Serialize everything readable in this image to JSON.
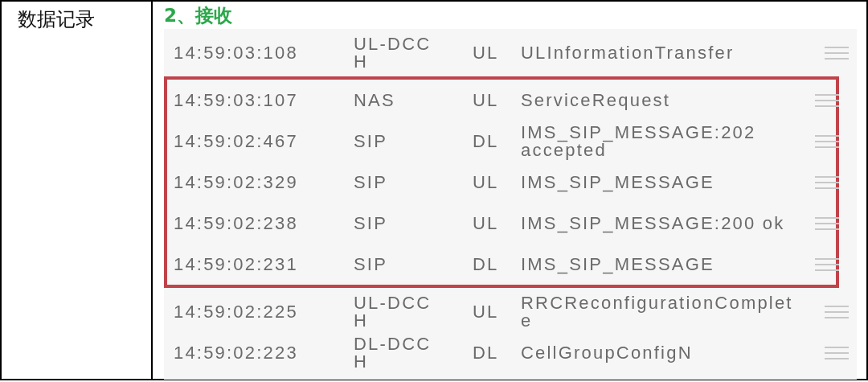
{
  "table_label": "数据记录",
  "section_title": "2、接收",
  "log_rows": [
    {
      "time": "14:59:03:108",
      "channel": "UL-DCCH",
      "direction": "UL",
      "message": "ULInformationTransfer",
      "highlighted": false
    },
    {
      "time": "14:59:03:107",
      "channel": "NAS",
      "direction": "UL",
      "message": "ServiceRequest",
      "highlighted": true
    },
    {
      "time": "14:59:02:467",
      "channel": "SIP",
      "direction": "DL",
      "message": "IMS_SIP_MESSAGE:202 accepted",
      "highlighted": true
    },
    {
      "time": "14:59:02:329",
      "channel": "SIP",
      "direction": "UL",
      "message": "IMS_SIP_MESSAGE",
      "highlighted": true
    },
    {
      "time": "14:59:02:238",
      "channel": "SIP",
      "direction": "UL",
      "message": "IMS_SIP_MESSAGE:200 ok",
      "highlighted": true
    },
    {
      "time": "14:59:02:231",
      "channel": "SIP",
      "direction": "DL",
      "message": "IMS_SIP_MESSAGE",
      "highlighted": true
    },
    {
      "time": "14:59:02:225",
      "channel": "UL-DCCH",
      "direction": "UL",
      "message": "RRCReconfigurationComplete",
      "highlighted": false
    },
    {
      "time": "14:59:02:223",
      "channel": "DL-DCCH",
      "direction": "DL",
      "message": "CellGroupConfigN",
      "highlighted": false
    }
  ]
}
